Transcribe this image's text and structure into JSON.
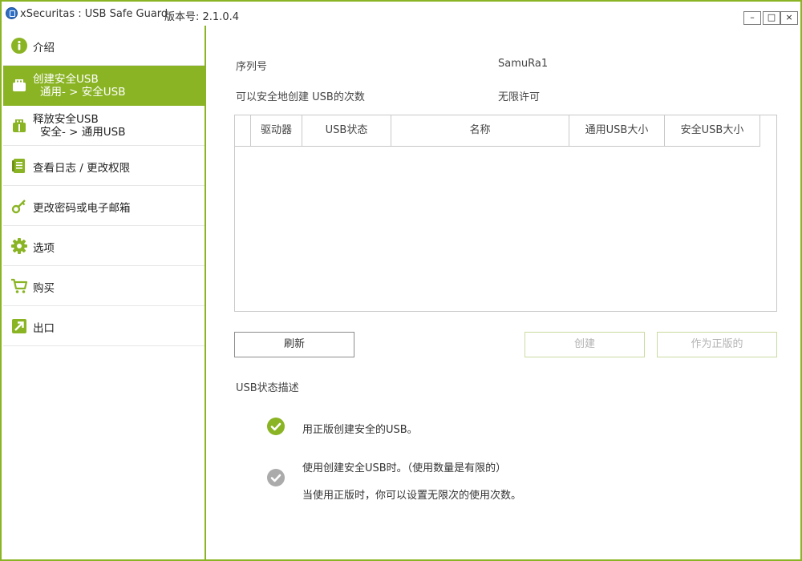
{
  "window": {
    "title": "xSecuritas : USB Safe Guard",
    "version_text": "版本号: 2.1.0.4",
    "minimize": "–",
    "maximize": "□",
    "close": "×"
  },
  "sidebar": {
    "items": [
      {
        "label": "介绍",
        "icon": "info-icon"
      },
      {
        "label": "创建安全USB",
        "sub": "通用- > 安全USB",
        "icon": "usb-icon",
        "active": true
      },
      {
        "label": "释放安全USB",
        "sub": "安全- > 通用USB",
        "icon": "usb-release-icon"
      },
      {
        "label": "查看日志 / 更改权限",
        "icon": "log-icon"
      },
      {
        "label": "更改密码或电子邮箱",
        "icon": "key-icon"
      },
      {
        "label": "选项",
        "icon": "gear-icon"
      },
      {
        "label": "购买",
        "icon": "cart-icon"
      },
      {
        "label": "出口",
        "icon": "exit-icon"
      }
    ]
  },
  "info": {
    "serial_label": "序列号",
    "serial_value": "SamuRa1",
    "count_label": "可以安全地创建 USB的次数",
    "count_value": "无限许可"
  },
  "table": {
    "columns": [
      "驱动器",
      "USB状态",
      "名称",
      "通用USB大小",
      "安全USB大小"
    ],
    "rows": []
  },
  "buttons": {
    "refresh": "刷新",
    "create": "创建",
    "as_licensed": "作为正版的"
  },
  "status_desc": {
    "title": "USB状态描述",
    "licensed": "用正版创建安全的USB。",
    "trial_line1": "使用创建安全USB时。（使用数量是有限的）",
    "trial_line2": "当使用正版时，你可以设置无限次的使用次数。"
  },
  "colors": {
    "accent": "#8ab424",
    "gray_check": "#ababab"
  }
}
